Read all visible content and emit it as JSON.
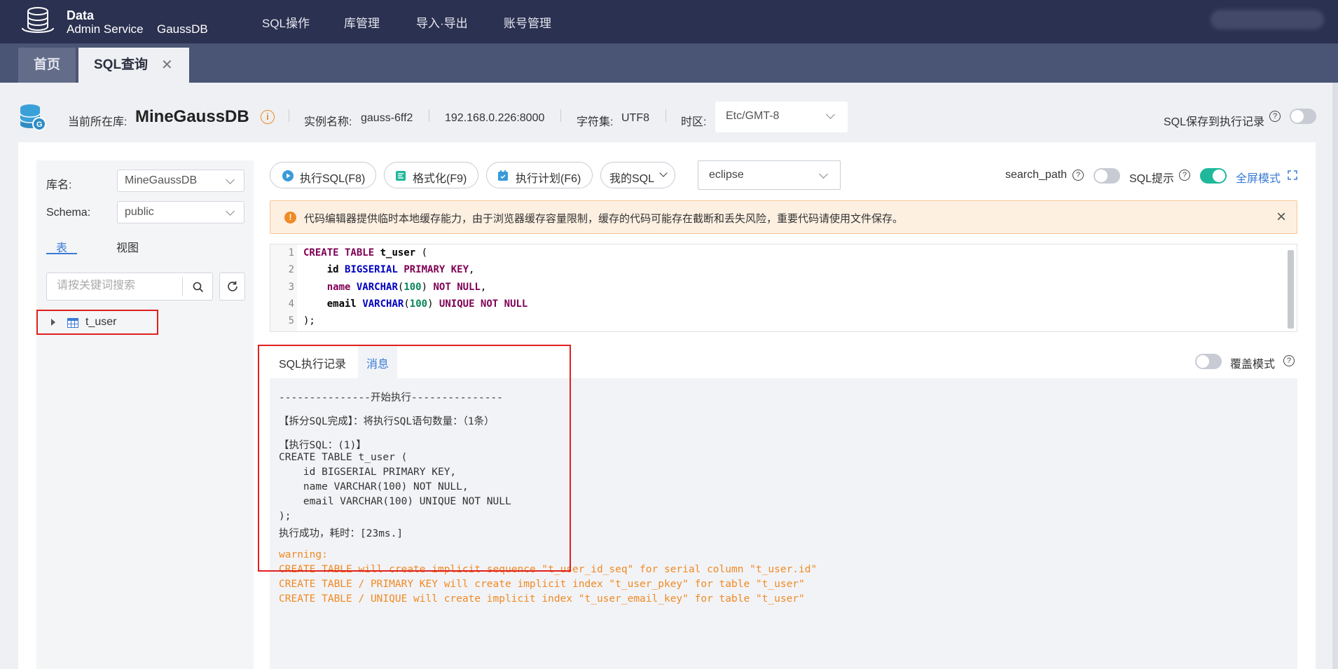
{
  "topbar": {
    "brand_line1": "Data",
    "brand_line2": "Admin Service",
    "brand_product": "GaussDB",
    "nav": [
      "SQL操作",
      "库管理",
      "导入·导出",
      "账号管理"
    ]
  },
  "tabs": {
    "home": "首页",
    "active": "SQL查询",
    "close_glyph": "✕"
  },
  "info": {
    "current_db_label": "当前所在库:",
    "current_db": "MineGaussDB",
    "instance_label": "实例名称:",
    "instance_name": "gauss-6ff2",
    "address": "192.168.0.226:8000",
    "charset_label": "字符集:",
    "charset": "UTF8",
    "timezone_label": "时区:",
    "timezone": "Etc/GMT-8",
    "save_history_label": "SQL保存到执行记录",
    "save_history_on": false
  },
  "left": {
    "db_label": "库名:",
    "db_value": "MineGaussDB",
    "schema_label": "Schema:",
    "schema_value": "public",
    "tab_tables": "表",
    "tab_views": "视图",
    "search_placeholder": "请按关键词搜索",
    "tree": [
      {
        "name": "t_user"
      }
    ]
  },
  "toolbar": {
    "execute": "执行SQL(F8)",
    "format": "格式化(F9)",
    "plan": "执行计划(F6)",
    "my_sql": "我的SQL",
    "theme": "eclipse",
    "search_path_label": "search_path",
    "search_path_on": false,
    "sql_hint_label": "SQL提示",
    "sql_hint_on": true,
    "fullscreen_label": "全屏模式",
    "accent_color": "#3a7bd5"
  },
  "alert": {
    "text": "代码编辑器提供临时本地缓存能力，由于浏览器缓存容量限制，缓存的代码可能存在截断和丢失风险，重要代码请使用文件保存。"
  },
  "editor": {
    "line_numbers": [
      "1",
      "2",
      "3",
      "4",
      "5"
    ]
  },
  "result": {
    "tab_history": "SQL执行记录",
    "tab_messages": "消息",
    "overwrite_label": "覆盖模式",
    "overwrite_on": false,
    "lines": [
      "---------------开始执行---------------",
      "【拆分SQL完成】：将执行SQL语句数量：（1条）",
      "【执行SQL：(1)】",
      "CREATE TABLE t_user (",
      "    id BIGSERIAL PRIMARY KEY,",
      "    name VARCHAR(100) NOT NULL,",
      "    email VARCHAR(100) UNIQUE NOT NULL",
      ");",
      "执行成功，耗时：[23ms.]"
    ],
    "warnings": [
      "warning:",
      "CREATE TABLE will create implicit sequence \"t_user_id_seq\" for serial column \"t_user.id\"",
      "CREATE TABLE / PRIMARY KEY will create implicit index \"t_user_pkey\" for table \"t_user\"",
      "CREATE TABLE / UNIQUE will create implicit index \"t_user_email_key\" for table \"t_user\""
    ],
    "warning_color": "#f08a24"
  }
}
